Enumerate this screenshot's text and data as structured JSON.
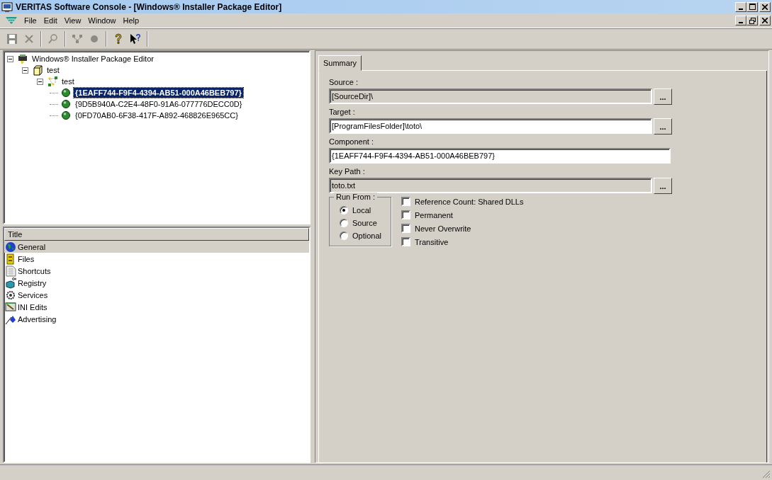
{
  "window": {
    "title": "VERITAS Software Console - [Windows® Installer Package Editor]"
  },
  "menu": [
    {
      "label": "File"
    },
    {
      "label": "Edit"
    },
    {
      "label": "View"
    },
    {
      "label": "Window"
    },
    {
      "label": "Help"
    }
  ],
  "toolbar": [
    {
      "disabled": true
    },
    {
      "disabled": true
    },
    {
      "disabled": true
    },
    {
      "disabled": true
    },
    {
      "disabled": true
    },
    {
      "disabled": false
    },
    {
      "disabled": false
    }
  ],
  "tree": [
    {
      "label": "Windows® Installer Package Editor",
      "expanded": true,
      "selected": false,
      "children": [
        {
          "label": "test",
          "expanded": true,
          "selected": false,
          "children": [
            {
              "label": "test",
              "expanded": true,
              "selected": false,
              "children": [
                {
                  "label": "{1EAFF744-F9F4-4394-AB51-000A46BEB797}",
                  "selected": true
                },
                {
                  "label": "{9D5B940A-C2E4-48F0-91A6-077776DECC0D}",
                  "selected": false
                },
                {
                  "label": "{0FD70AB0-6F38-417F-A892-468826E965CC}",
                  "selected": false
                }
              ]
            }
          ]
        }
      ]
    }
  ],
  "categories": {
    "column": "Title",
    "items": [
      {
        "label": "General",
        "selected": true
      },
      {
        "label": "Files",
        "selected": false
      },
      {
        "label": "Shortcuts",
        "selected": false
      },
      {
        "label": "Registry",
        "selected": false
      },
      {
        "label": "Services",
        "selected": false
      },
      {
        "label": "INI Edits",
        "selected": false
      },
      {
        "label": "Advertising",
        "selected": false
      }
    ]
  },
  "tabs": [
    {
      "label": "Summary",
      "selected": true
    }
  ],
  "fields": [
    {
      "label": "Source :",
      "value": "[SourceDir]\\",
      "readonly": true,
      "browse": true
    },
    {
      "label": "Target :",
      "value": "[ProgramFilesFolder]\\toto\\",
      "readonly": false,
      "browse": true
    },
    {
      "label": "Component :",
      "value": "{1EAFF744-F9F4-4394-AB51-000A46BEB797}",
      "readonly": false,
      "browse": false
    },
    {
      "label": "Key Path :",
      "value": "toto.txt",
      "readonly": true,
      "browse": true
    }
  ],
  "browse_label": "...",
  "run_from": {
    "title": "Run From :",
    "options": [
      {
        "label": "Local",
        "selected": true
      },
      {
        "label": "Source",
        "selected": false
      },
      {
        "label": "Optional",
        "selected": false
      }
    ]
  },
  "options": [
    {
      "label": "Reference Count: Shared DLLs",
      "checked": false
    },
    {
      "label": "Permanent",
      "checked": false
    },
    {
      "label": "Never Overwrite",
      "checked": false
    },
    {
      "label": "Transitive",
      "checked": false
    }
  ]
}
